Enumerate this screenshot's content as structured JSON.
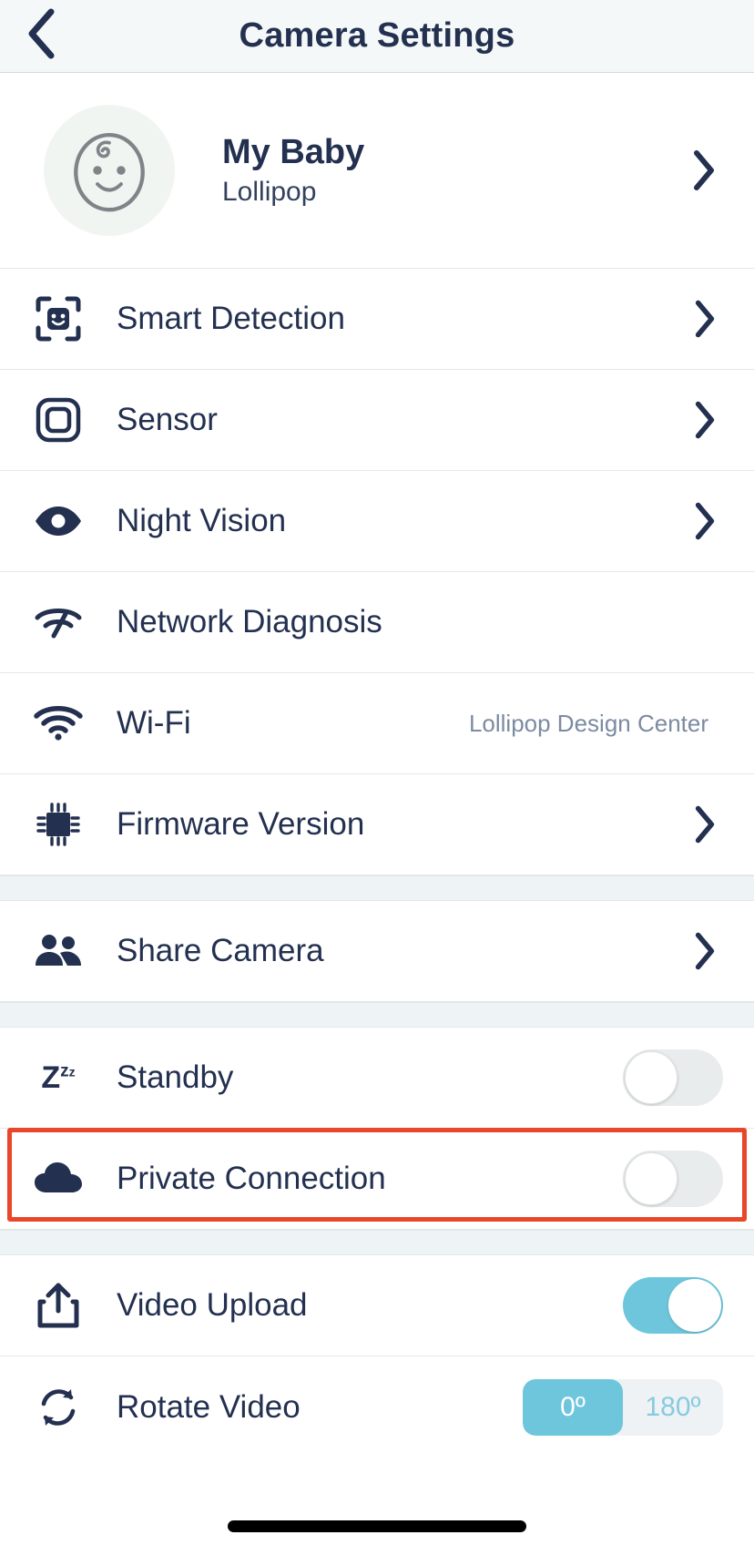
{
  "header": {
    "title": "Camera Settings",
    "back_icon": "chevron-left-icon"
  },
  "profile": {
    "avatar_icon": "baby-face-icon",
    "name": "My Baby",
    "subtitle": "Lollipop",
    "chevron_icon": "chevron-right-icon"
  },
  "sections": [
    {
      "rows": [
        {
          "icon": "smart-detection-face-icon",
          "label": "Smart Detection",
          "accessory": "chevron"
        },
        {
          "icon": "sensor-square-icon",
          "label": "Sensor",
          "accessory": "chevron"
        },
        {
          "icon": "night-vision-eye-icon",
          "label": "Night Vision",
          "accessory": "chevron"
        },
        {
          "icon": "network-diagnosis-icon",
          "label": "Network Diagnosis",
          "accessory": "none"
        },
        {
          "icon": "wifi-icon",
          "label": "Wi-Fi",
          "accessory": "value",
          "value": "Lollipop Design Center"
        },
        {
          "icon": "firmware-chip-icon",
          "label": "Firmware Version",
          "accessory": "chevron"
        }
      ]
    },
    {
      "rows": [
        {
          "icon": "share-people-icon",
          "label": "Share Camera",
          "accessory": "chevron"
        }
      ]
    },
    {
      "rows": [
        {
          "icon": "standby-zzz-icon",
          "label": "Standby",
          "accessory": "toggle",
          "toggle_on": false
        },
        {
          "icon": "cloud-icon",
          "label": "Private Connection",
          "accessory": "toggle",
          "toggle_on": false,
          "highlighted": true
        }
      ]
    },
    {
      "rows": [
        {
          "icon": "video-upload-icon",
          "label": "Video Upload",
          "accessory": "toggle",
          "toggle_on": true
        },
        {
          "icon": "rotate-video-icon",
          "label": "Rotate Video",
          "accessory": "segmented"
        }
      ]
    }
  ],
  "rotate_video": {
    "options": [
      "0º",
      "180º"
    ],
    "selected": "0º"
  },
  "colors": {
    "accent_blue": "#6ec6dd",
    "text_dark": "#23304f",
    "muted_text": "#7c8ba1",
    "highlight_red": "#e8472b",
    "header_bg": "#f4f8f8",
    "section_gap": "#eef3f5"
  }
}
